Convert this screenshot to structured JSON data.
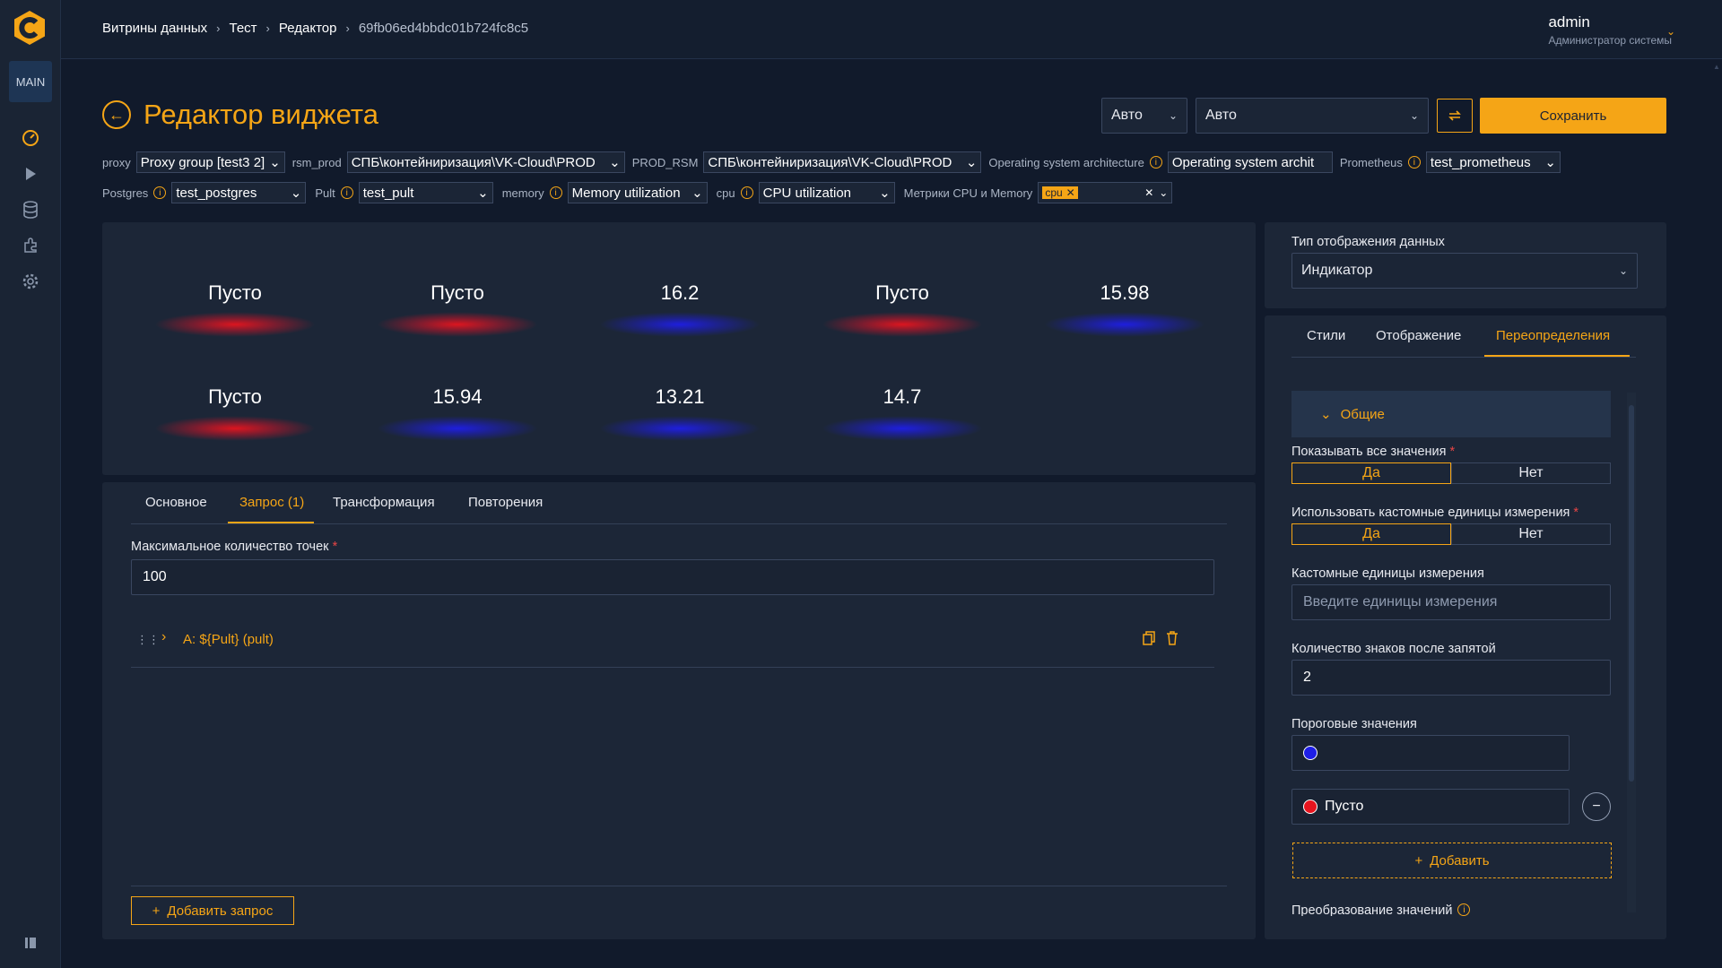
{
  "sidebar": {
    "workspace_badge": "MAIN",
    "icons": [
      "dashboard-icon",
      "play-icon",
      "database-icon",
      "plugin-icon",
      "gear-icon"
    ]
  },
  "breadcrumbs": [
    "Витрины данных",
    "Тест",
    "Редактор",
    "69fb06ed4bbdc01b724fc8c5"
  ],
  "user": {
    "name": "admin",
    "role": "Администратор системы"
  },
  "header": {
    "title": "Редактор виджета",
    "interval_select": "Авто",
    "refresh_select": "Авто",
    "save_label": "Сохранить"
  },
  "variables": {
    "row1": [
      {
        "label": "proxy",
        "value": "Proxy group [test3 2]",
        "info": false
      },
      {
        "label": "rsm_prod",
        "value": "СПБ\\контейниризация\\VK-Cloud\\PROD",
        "info": false
      },
      {
        "label": "PROD_RSM",
        "value": "СПБ\\контейниризация\\VK-Cloud\\PROD",
        "info": false
      },
      {
        "label": "Operating system architecture",
        "value": "Operating system archit",
        "info": true
      },
      {
        "label": "Prometheus",
        "value": "test_prometheus",
        "info": true
      }
    ],
    "row2": [
      {
        "label": "Postgres",
        "value": "test_postgres",
        "info": true
      },
      {
        "label": "Pult",
        "value": "test_pult",
        "info": true
      },
      {
        "label": "memory",
        "value": "Memory utilization",
        "info": true
      },
      {
        "label": "cpu",
        "value": "CPU utilization",
        "info": true
      },
      {
        "label": "Метрики CPU и Memory",
        "value": "",
        "info": false,
        "chip": "cpu"
      }
    ]
  },
  "preview": {
    "cells": [
      {
        "value": "Пусто",
        "color": "red"
      },
      {
        "value": "Пусто",
        "color": "red"
      },
      {
        "value": "16.2",
        "color": "blue"
      },
      {
        "value": "Пусто",
        "color": "red"
      },
      {
        "value": "15.98",
        "color": "blue"
      },
      {
        "value": "Пусто",
        "color": "red"
      },
      {
        "value": "15.94",
        "color": "blue"
      },
      {
        "value": "13.21",
        "color": "blue"
      },
      {
        "value": "14.7",
        "color": "blue"
      }
    ]
  },
  "editor": {
    "tabs": [
      "Основное",
      "Запрос (1)",
      "Трансформация",
      "Повторения"
    ],
    "active_tab": "Запрос (1)",
    "max_points_label": "Максимальное количество точек",
    "max_points_value": "100",
    "query_row": "A: ${Pult} (pult)",
    "add_query": "Добавить запрос"
  },
  "right": {
    "display_type_label": "Тип отображения данных",
    "display_type_value": "Индикатор",
    "tabs": [
      "Стили",
      "Отображение",
      "Переопределения"
    ],
    "active_tab": "Переопределения",
    "section": "Общие",
    "show_all_label": "Показывать все значения",
    "custom_units_toggle_label": "Использовать кастомные единицы измерения",
    "yes": "Да",
    "no": "Нет",
    "custom_units_label": "Кастомные единицы измерения",
    "custom_units_placeholder": "Введите единицы измерения",
    "decimals_label": "Количество знаков после запятой",
    "decimals_value": "2",
    "thresholds_label": "Пороговые значения",
    "threshold1_value": "",
    "threshold2_value": "Пусто",
    "add_label": "Добавить",
    "transform_label": "Преобразование значений"
  },
  "colors": {
    "accent": "#f5a516",
    "red": "#e8141e",
    "blue": "#1e1ee6"
  }
}
